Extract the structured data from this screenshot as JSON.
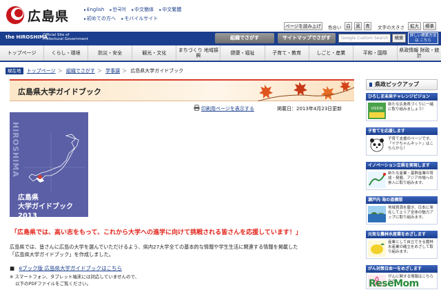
{
  "header": {
    "logo_text": "広島県",
    "pref_en": "the HIROSHIMA",
    "pref_sub": [
      "Official Site of",
      "Prefectural Government"
    ],
    "lang_links": [
      "English",
      "한국어",
      "中文簡体",
      "中文繁體",
      "初めての方へ",
      "モバイルサイト"
    ],
    "read_aloud": "ページを読み上げ",
    "color_label": "色合い",
    "color_options": [
      "白",
      "黒",
      "青"
    ],
    "font_size_label": "文字の大きさ",
    "font_up": "拡大",
    "font_std": "標準",
    "org_search": "組織でさがす",
    "sitemap_search": "サイトマップでさがす",
    "search_placeholder": "Google Custom Search",
    "search_button": "検索",
    "detail_search": "詳しい検索方法は こちら"
  },
  "gnav": [
    "トップページ",
    "くらし・環境",
    "防災・安全",
    "観光・文化",
    "まちづくり 地域振興",
    "健康・福祉",
    "子育て・教育",
    "しごと・産業",
    "平和・国際",
    "県政情報 財政・統計"
  ],
  "breadcrumb": {
    "here": "現在地",
    "items": [
      "トップページ",
      "組織でさがす",
      "学事課",
      "広島県大学ガイドブック"
    ]
  },
  "main": {
    "title": "広島県大学ガイドブック",
    "print_link": "印刷用ページを表示する",
    "posted": "掲載日：2013年4月23日更新",
    "cover_vertical": "HIROSHIMA",
    "cover_title_line1": "広島県",
    "cover_title_line2": "大学ガイドブック 2013",
    "lead": "「広島県では、高い志をもって、これから大学への進学に向けて挑戦される皆さんを応援しています！」",
    "body_line1": "広島県では、皆さんに広島の大学を選んでいただけるよう、県内27大学全ての基本的な情報や学生生活に関連する情報を掲載した",
    "body_line2": "「広島県大学ガイドブック」を作成しました。",
    "ebook_link": "eブック版 広島県大学ガイドブックはこちら",
    "note_line1": "※ スマートフォン、タブレット端末には対応していませんので、",
    "note_line2": "以下のPDFファイルをご覧ください。"
  },
  "sidebar": {
    "heading": "県政ピックアップ",
    "blocks": [
      {
        "title": "ひろしま未来チャレンジビジョン",
        "text": "新たな広島県づくりに一緒に取り組みましょう！"
      },
      {
        "title": "子育てを応援します",
        "text": "子育て支援のページです。「イクちゃんネット」はこちらから！"
      },
      {
        "title": "イノベーション立県を実現します",
        "text": "新たな産業・基幹産業の育成・発展、アジア市場への参入に取り組みます。"
      },
      {
        "title": "瀬戸内 海の道構想",
        "text": "地域資源を磨き、日本に滞在してエリア全体の魅力アップに取り組みます。"
      },
      {
        "title": "元気な農林水産業をめざします",
        "text": "産業として自立できる農林水産業の確立をめざして取り組みます。"
      },
      {
        "title": "がん対策日本一をめざします",
        "text": "がんに関する情報はこちらから"
      }
    ]
  },
  "watermark": "ReseMom"
}
